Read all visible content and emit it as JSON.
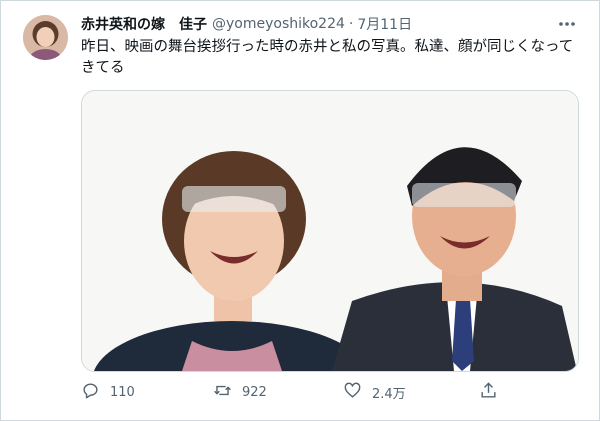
{
  "tweet": {
    "author_name": "赤井英和の嫁　佳子",
    "handle": "@yomeyoshiko224",
    "separator": "·",
    "date": "7月11日",
    "more_icon": "more-horizontal-icon",
    "text": "昨日、映画の舞台挨拶行った時の赤井と私の写真。私達、顔が同じくなってきてる"
  },
  "actions": {
    "reply_icon": "reply-icon",
    "reply_count": "110",
    "retweet_icon": "retweet-icon",
    "retweet_count": "922",
    "like_icon": "heart-icon",
    "like_count": "2.4万",
    "share_icon": "share-icon"
  },
  "colors": {
    "text": "#0f1419",
    "muted": "#536471",
    "border": "#cfd9de"
  }
}
